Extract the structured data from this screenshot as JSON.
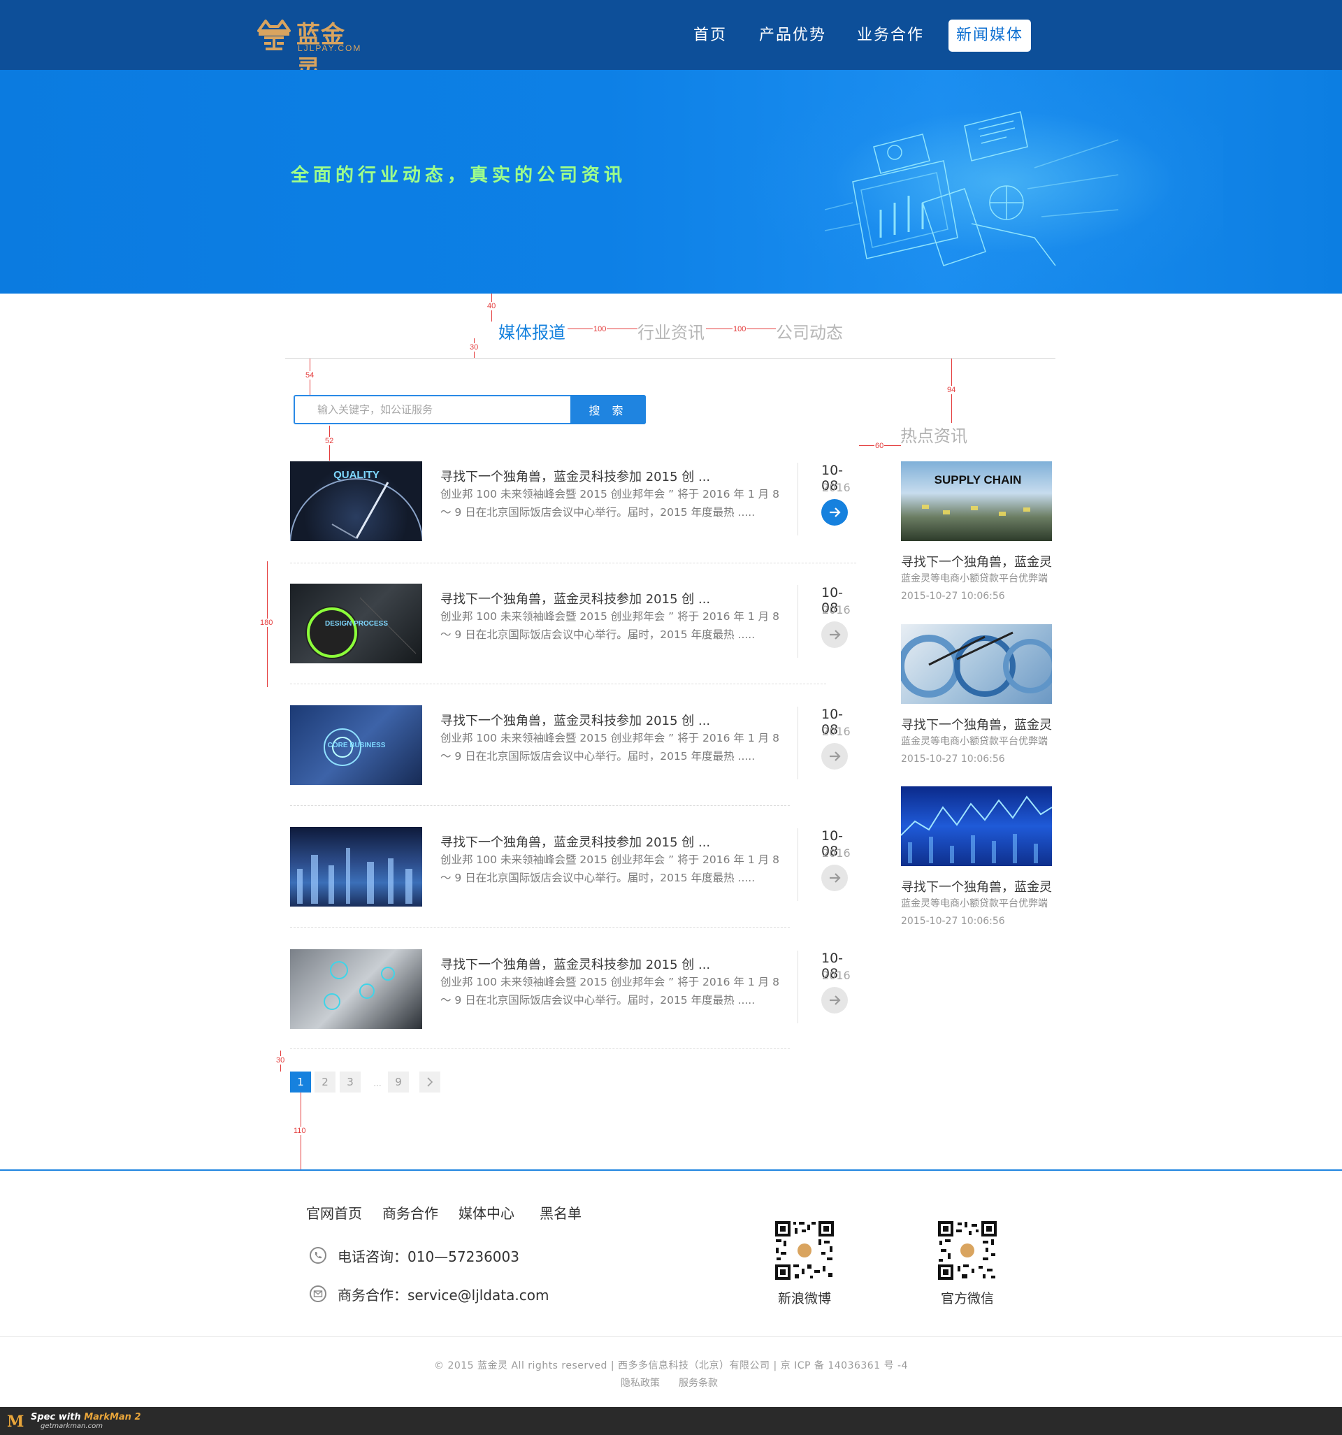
{
  "brand": {
    "name": "蓝金灵",
    "domain": "LJLPAY.COM",
    "brand_color": "#0d4f99",
    "logo_color": "#d9a45f"
  },
  "nav": {
    "items": [
      "首页",
      "产品优势",
      "业务合作",
      "新闻媒体"
    ],
    "active_index": 3
  },
  "banner": {
    "slogan": "全面的行业动态，真实的公司资讯",
    "bg_color": "#0d80e6",
    "slogan_color": "#9fff8a"
  },
  "tabs": {
    "items": [
      "媒体报道",
      "行业资讯",
      "公司动态"
    ],
    "active_index": 0,
    "active_color": "#1481dd"
  },
  "search": {
    "placeholder": "输入关键字，如公证服务",
    "button_label": "搜 索"
  },
  "news": [
    {
      "title": "寻找下一个独角兽，蓝金灵科技参加 2015 创 ...",
      "desc": "创业邦 100 未来领袖峰会暨 2015 创业邦年会 ” 将于 2016 年 1 月 8 ～ 9 日在北京国际饭店会议中心举行。届时，2015 年度最热 .....",
      "date": "10-08",
      "year": "2016",
      "thumb_text": "QUALITY",
      "arrow": "arrow-right-icon",
      "arrow_active": true
    },
    {
      "title": "寻找下一个独角兽，蓝金灵科技参加 2015 创 ...",
      "desc": "创业邦 100 未来领袖峰会暨 2015 创业邦年会 ” 将于 2016 年 1 月 8 ～ 9 日在北京国际饭店会议中心举行。届时，2015 年度最热 .....",
      "date": "10-08",
      "year": "2016",
      "thumb_text": "DESIGN PROCESS",
      "arrow": "arrow-right-icon",
      "arrow_active": false
    },
    {
      "title": "寻找下一个独角兽，蓝金灵科技参加 2015 创 ...",
      "desc": "创业邦 100 未来领袖峰会暨 2015 创业邦年会 ” 将于 2016 年 1 月 8 ～ 9 日在北京国际饭店会议中心举行。届时，2015 年度最热 .....",
      "date": "10-08",
      "year": "2016",
      "thumb_text": "CORE BUSINESS",
      "arrow": "arrow-right-icon",
      "arrow_active": false
    },
    {
      "title": "寻找下一个独角兽，蓝金灵科技参加 2015 创 ...",
      "desc": "创业邦 100 未来领袖峰会暨 2015 创业邦年会 ” 将于 2016 年 1 月 8 ～ 9 日在北京国际饭店会议中心举行。届时，2015 年度最热 .....",
      "date": "10-08",
      "year": "2016",
      "thumb_text": "",
      "arrow": "arrow-right-icon",
      "arrow_active": false
    },
    {
      "title": "寻找下一个独角兽，蓝金灵科技参加 2015 创 ...",
      "desc": "创业邦 100 未来领袖峰会暨 2015 创业邦年会 ” 将于 2016 年 1 月 8 ～ 9 日在北京国际饭店会议中心举行。届时，2015 年度最热 .....",
      "date": "10-08",
      "year": "2016",
      "thumb_text": "",
      "arrow": "arrow-right-icon",
      "arrow_active": false
    }
  ],
  "pagination": {
    "pages": [
      "1",
      "2",
      "3",
      "9"
    ],
    "ellipsis": "...",
    "current": "1",
    "next_icon": "chevron-right-icon"
  },
  "hot": {
    "title": "热点资讯",
    "items": [
      {
        "thumb_text": "SUPPLY CHAIN",
        "title": "寻找下一个独角兽，蓝金灵",
        "sub": "蓝金灵等电商小额贷款平台优弊端",
        "time": "2015-10-27 10:06:56"
      },
      {
        "thumb_text": "",
        "title": "寻找下一个独角兽，蓝金灵",
        "sub": "蓝金灵等电商小额贷款平台优弊端",
        "time": "2015-10-27 10:06:56"
      },
      {
        "thumb_text": "",
        "title": "寻找下一个独角兽，蓝金灵",
        "sub": "蓝金灵等电商小额贷款平台优弊端",
        "time": "2015-10-27 10:06:56"
      }
    ]
  },
  "annotations": {
    "values": [
      "40",
      "100",
      "100",
      "30",
      "54",
      "94",
      "52",
      "60",
      "180",
      "30",
      "110"
    ],
    "color": "#e43d3d"
  },
  "footer": {
    "links": [
      "官网首页",
      "商务合作",
      "媒体中心",
      "黑名单"
    ],
    "phone": "电话咨询：010—57236003",
    "email": "商务合作：service@ljldata.com",
    "qr": [
      {
        "label": "新浪微博"
      },
      {
        "label": "官方微信"
      }
    ],
    "copyright": "© 2015 蓝金灵 All rights reserved | 西多多信息科技（北京）有限公司 | 京 ICP 备 14036361 号 -4",
    "privacy": "隐私政策",
    "terms": "服务条款",
    "accent_color": "#1e84df"
  },
  "markman": {
    "text": "Spec with",
    "product": "MarkMan 2",
    "site": "getmarkman.com"
  }
}
